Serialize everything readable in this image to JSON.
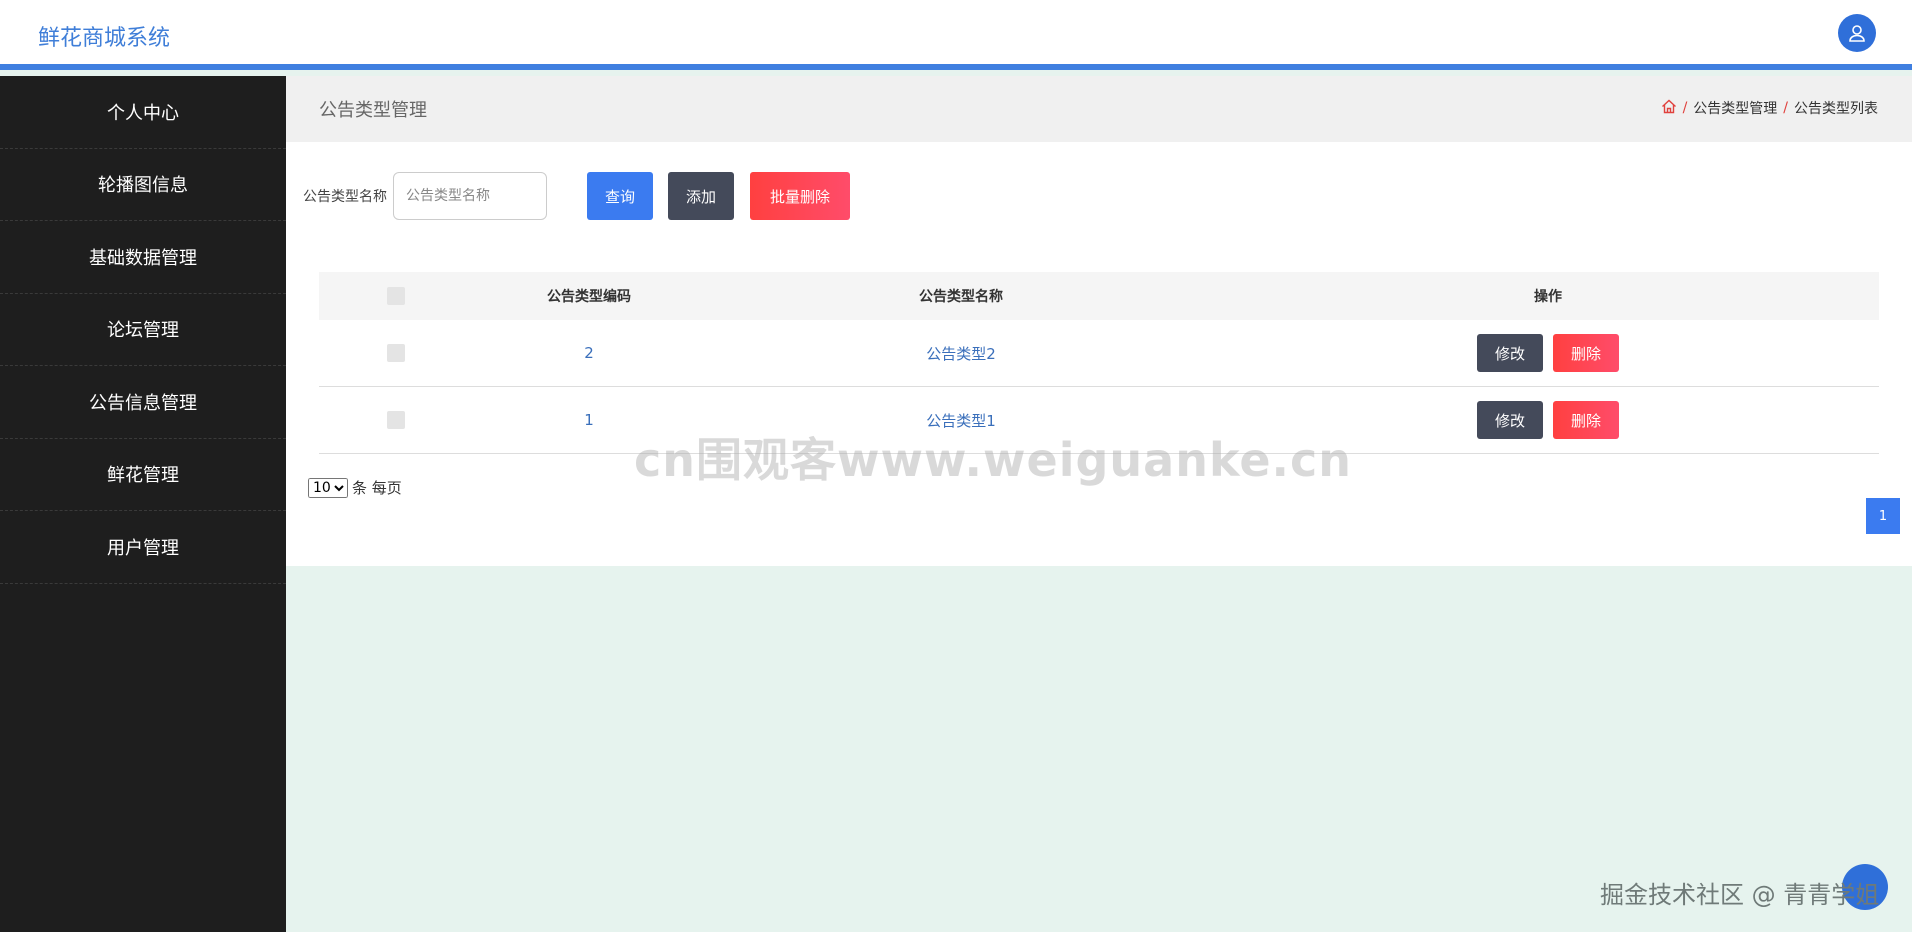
{
  "app": {
    "title": "鲜花商城系统"
  },
  "sidebar": {
    "items": [
      {
        "label": "个人中心"
      },
      {
        "label": "轮播图信息"
      },
      {
        "label": "基础数据管理"
      },
      {
        "label": "论坛管理"
      },
      {
        "label": "公告信息管理"
      },
      {
        "label": "鲜花管理"
      },
      {
        "label": "用户管理"
      }
    ]
  },
  "page": {
    "title": "公告类型管理",
    "breadcrumb": [
      "公告类型管理",
      "公告类型列表"
    ]
  },
  "search": {
    "label": "公告类型名称",
    "placeholder": "公告类型名称",
    "query_label": "查询",
    "add_label": "添加",
    "batch_delete_label": "批量删除"
  },
  "table": {
    "headers": {
      "code": "公告类型编码",
      "name": "公告类型名称",
      "op": "操作"
    },
    "rows": [
      {
        "code": "2",
        "name": "公告类型2",
        "edit": "修改",
        "delete": "删除"
      },
      {
        "code": "1",
        "name": "公告类型1",
        "edit": "修改",
        "delete": "删除"
      }
    ]
  },
  "pagination": {
    "page_size": "10",
    "page_size_suffix": "条 每页",
    "current_page": "1"
  },
  "float_ball": {
    "text": "--:--"
  },
  "watermarks": {
    "center": "cn围观客www.weiguanke.cn",
    "corner": "掘金技术社区 @ 青青学姐"
  },
  "colors": {
    "primary": "#3b7bf0",
    "sidebar_bg": "#1e1e1e",
    "danger": "#ff4040",
    "dark_button": "#444a5a",
    "page_bg": "#e6f3ee"
  }
}
